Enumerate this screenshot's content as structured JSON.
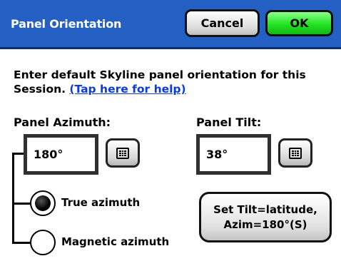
{
  "header": {
    "title": "Panel Orientation",
    "cancel_label": "Cancel",
    "ok_label": "OK"
  },
  "intro": {
    "text": "Enter default Skyline panel orientation for this Session.",
    "help_link": "(Tap here for help)"
  },
  "azimuth": {
    "label": "Panel Azimuth:",
    "value": "180°",
    "options": [
      {
        "label": "True azimuth",
        "selected": true
      },
      {
        "label": "Magnetic azimuth",
        "selected": false
      }
    ]
  },
  "tilt": {
    "label": "Panel Tilt:",
    "value": "38°"
  },
  "set_tilt_button": {
    "line1": "Set Tilt=latitude,",
    "line2": "Azim=180°(S)"
  },
  "icons": {
    "keypad": "keypad-icon",
    "radio_selected": "radio-selected-icon",
    "radio_unselected": "radio-unselected-icon"
  },
  "colors": {
    "titlebar": "#2460c4",
    "ok_button": "#22e322",
    "link": "#0b3be0"
  }
}
